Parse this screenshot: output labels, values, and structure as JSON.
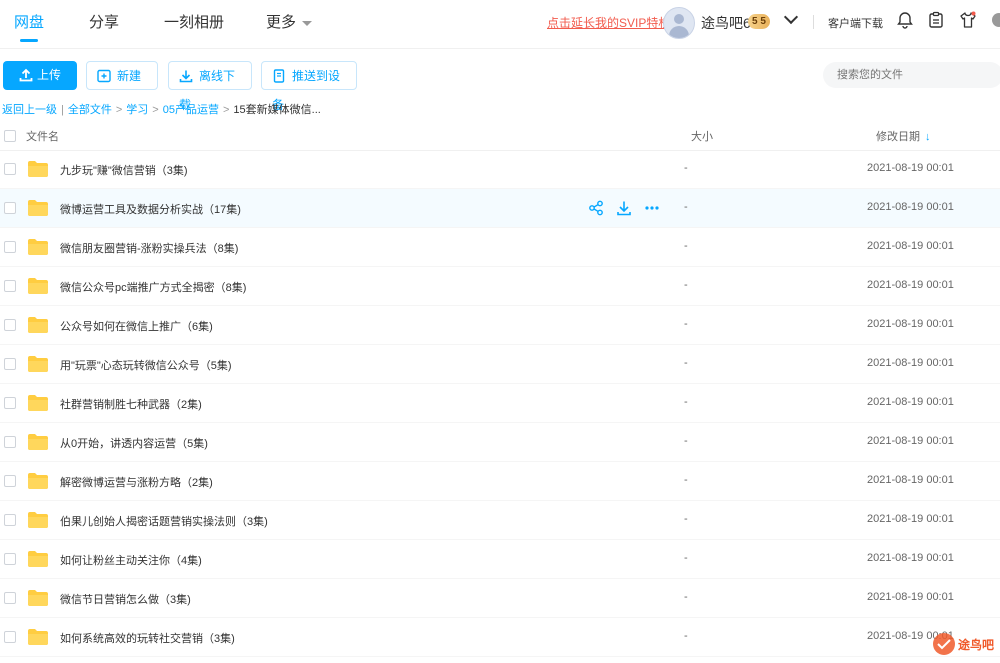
{
  "nav": {
    "tabs": [
      {
        "label": "网盘",
        "active": true
      },
      {
        "label": "分享"
      },
      {
        "label": "一刻相册"
      },
      {
        "label": "更多"
      }
    ],
    "svip_link": "点击延长我的SVIP特权",
    "username": "途鸟吧6",
    "vip_level": "5 5",
    "client_download": "客户端下载",
    "icons": [
      "bell-icon",
      "clipboard-icon",
      "shirt-icon"
    ]
  },
  "toolbar": {
    "upload": "上传",
    "new": "新建",
    "offline_download": "离线下载",
    "push_device": "推送到设备",
    "search_placeholder": "搜索您的文件"
  },
  "breadcrumb": {
    "back": "返回上一级",
    "items": [
      "全部文件",
      "学习",
      "05产品运营",
      "15套新媒体微信..."
    ]
  },
  "table": {
    "headers": {
      "name": "文件名",
      "size": "大小",
      "date": "修改日期"
    },
    "sort_indicator": "↓",
    "rows": [
      {
        "name": "九步玩\"赚\"微信营销（3集)",
        "size": "-",
        "date": "2021-08-19 00:01"
      },
      {
        "name": "微博运营工具及数据分析实战（17集)",
        "size": "-",
        "date": "2021-08-19 00:01",
        "hover": true
      },
      {
        "name": "微信朋友圈营销-涨粉实操兵法（8集)",
        "size": "-",
        "date": "2021-08-19 00:01"
      },
      {
        "name": "微信公众号pc端推广方式全揭密（8集)",
        "size": "-",
        "date": "2021-08-19 00:01"
      },
      {
        "name": "公众号如何在微信上推广（6集)",
        "size": "-",
        "date": "2021-08-19 00:01"
      },
      {
        "name": "用\"玩票\"心态玩转微信公众号（5集)",
        "size": "-",
        "date": "2021-08-19 00:01"
      },
      {
        "name": "社群营销制胜七种武器（2集)",
        "size": "-",
        "date": "2021-08-19 00:01"
      },
      {
        "name": "从0开始，讲透内容运营（5集)",
        "size": "-",
        "date": "2021-08-19 00:01"
      },
      {
        "name": "解密微博运营与涨粉方略（2集)",
        "size": "-",
        "date": "2021-08-19 00:01"
      },
      {
        "name": "伯果儿创始人揭密话题营销实操法则（3集)",
        "size": "-",
        "date": "2021-08-19 00:01"
      },
      {
        "name": "如何让粉丝主动关注你（4集)",
        "size": "-",
        "date": "2021-08-19 00:01"
      },
      {
        "name": "微信节日营销怎么做（3集)",
        "size": "-",
        "date": "2021-08-19 00:01"
      },
      {
        "name": "如何系统高效的玩转社交营销（3集)",
        "size": "-",
        "date": "2021-08-19 00:01"
      }
    ]
  },
  "watermark": "途鸟吧",
  "colors": {
    "accent": "#06a7ff",
    "svip": "#f25b4d",
    "folder": "#ffcd41"
  }
}
